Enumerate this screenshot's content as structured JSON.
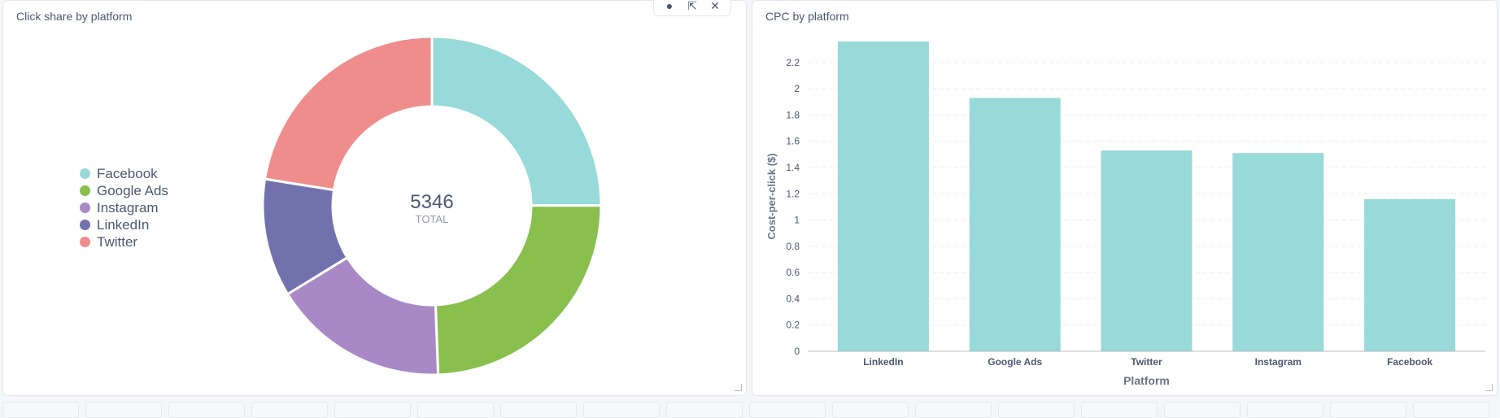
{
  "left_card": {
    "title": "Click share by platform",
    "toolbar": {
      "palette_icon": "palette-icon",
      "click_behavior_icon": "click-behavior-icon",
      "remove_icon": "close-icon"
    }
  },
  "right_card": {
    "title": "CPC by platform"
  },
  "colors": {
    "Facebook": "#98d9d9",
    "Google Ads": "#88bf4d",
    "Instagram": "#a989c5",
    "LinkedIn": "#7172ad",
    "Twitter": "#ef8c8c",
    "bar": "#98d9d9"
  },
  "chart_data": [
    {
      "type": "pie",
      "variant": "donut",
      "title": "Click share by platform",
      "labels": [
        "Facebook",
        "Google Ads",
        "Instagram",
        "LinkedIn",
        "Twitter"
      ],
      "values": [
        1335,
        1307,
        900,
        603,
        1201
      ],
      "center": {
        "value": "5346",
        "label": "TOTAL"
      },
      "legend": "left"
    },
    {
      "type": "bar",
      "title": "CPC by platform",
      "categories": [
        "LinkedIn",
        "Google Ads",
        "Twitter",
        "Instagram",
        "Facebook"
      ],
      "values": [
        2.36,
        1.93,
        1.53,
        1.51,
        1.16
      ],
      "xlabel": "Platform",
      "ylabel": "Cost-per-click ($)",
      "ylim": [
        0,
        2.36
      ],
      "yticks": [
        0,
        0.2,
        0.4,
        0.6,
        0.8,
        1,
        1.2,
        1.4,
        1.6,
        1.8,
        2,
        2.2
      ],
      "ytick_labels": [
        "0",
        "0.2",
        "0.4",
        "0.6",
        "0.8",
        "1",
        "1.2",
        "1.4",
        "1.6",
        "1.8",
        "2",
        "2.2"
      ],
      "grid": true
    }
  ]
}
